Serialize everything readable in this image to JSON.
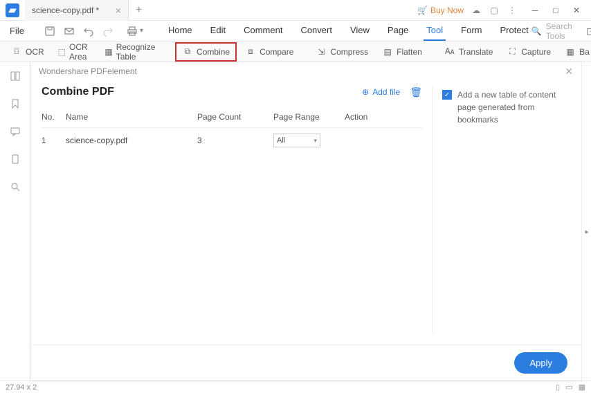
{
  "titlebar": {
    "tab_name": "science-copy.pdf *",
    "buy_now": "Buy Now"
  },
  "menubar": {
    "file": "File",
    "tabs": [
      "Home",
      "Edit",
      "Comment",
      "Convert",
      "View",
      "Page",
      "Tool",
      "Form",
      "Protect"
    ],
    "active_tab": "Tool",
    "search_placeholder": "Search Tools"
  },
  "toolbar": {
    "ocr": "OCR",
    "ocr_area": "OCR Area",
    "recognize_table": "Recognize Table",
    "combine": "Combine",
    "compare": "Compare",
    "compress": "Compress",
    "flatten": "Flatten",
    "translate": "Translate",
    "capture": "Capture",
    "batch": "Ba"
  },
  "panel": {
    "header_title": "Wondershare PDFelement",
    "title": "Combine PDF",
    "add_file": "Add file",
    "columns": {
      "no": "No.",
      "name": "Name",
      "page_count": "Page Count",
      "page_range": "Page Range",
      "action": "Action"
    },
    "rows": [
      {
        "no": "1",
        "name": "science-copy.pdf",
        "page_count": "3",
        "page_range": "All"
      }
    ],
    "side": {
      "checkbox_label": "Add a new table of content page generated from bookmarks"
    },
    "apply": "Apply"
  },
  "statusbar": {
    "dimensions": "27.94 x 2"
  }
}
